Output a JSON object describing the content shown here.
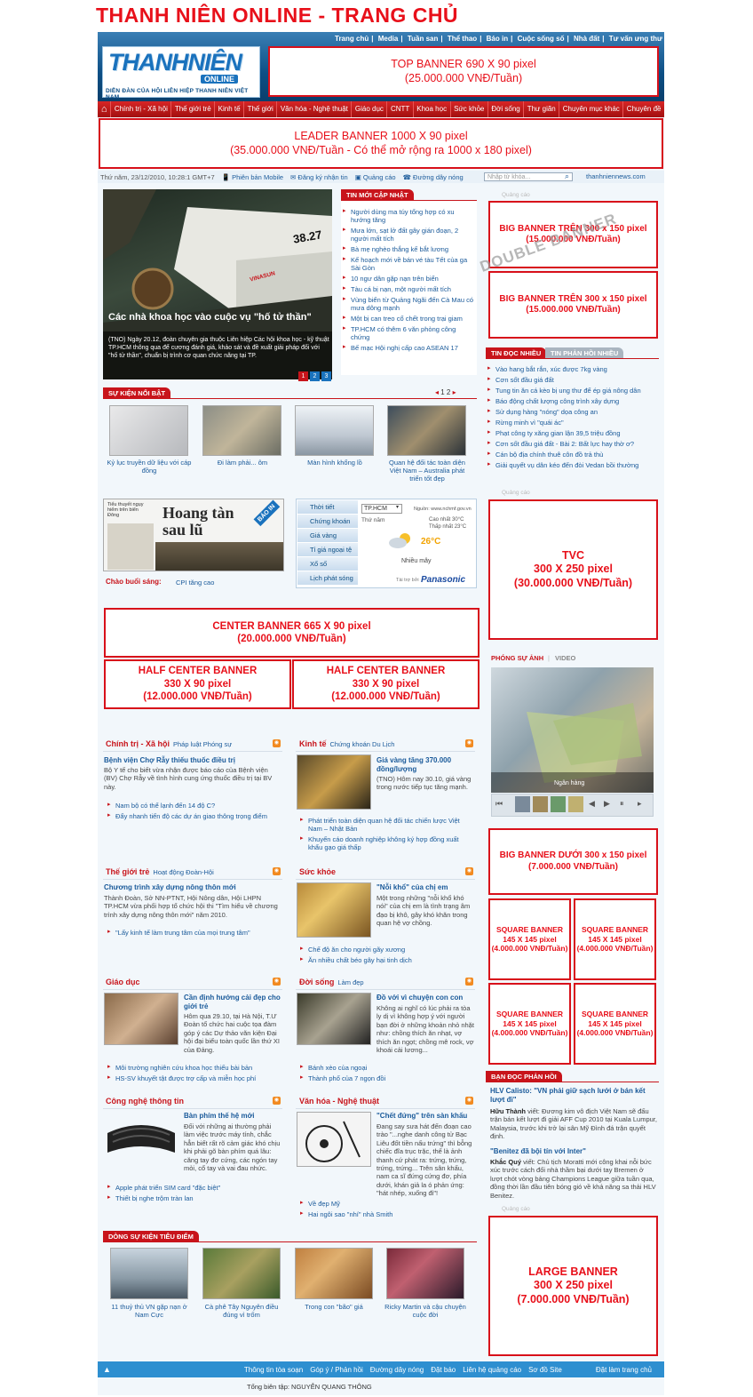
{
  "page_title": "THANH NIÊN ONLINE - TRANG CHỦ",
  "logo": {
    "main": "THANHNIÊN",
    "sub": "ONLINE",
    "tagline": "DIỄN ĐÀN CỦA HỘI LIÊN HIỆP THANH NIÊN VIỆT NAM"
  },
  "top_nav": [
    "Trang chủ",
    "Media",
    "Tuần san",
    "Thể thao",
    "Báo in",
    "Cuộc sống số",
    "Nhà đất",
    "Tư vấn ưng thư"
  ],
  "top_banner": {
    "line1": "TOP BANNER 690 X 90 pixel",
    "line2": "(25.000.000 VNĐ/Tuần)"
  },
  "main_nav": [
    "Chính trị - Xã hội",
    "Thế giới trẻ",
    "Kinh tế",
    "Thế giới",
    "Văn hóa - Nghệ thuật",
    "Giáo dục",
    "CNTT",
    "Khoa học",
    "Sức khỏe",
    "Đời sống",
    "Thư giãn",
    "Chuyên mục khác",
    "Chuyên đề"
  ],
  "leader_banner": {
    "line1": "LEADER BANNER 1000 X 90 pixel",
    "line2": "(35.000.000 VNĐ/Tuần - Có thể mở rộng ra 1000 x 180 pixel)"
  },
  "toolbar": {
    "date": "Thứ năm, 23/12/2010, 10:28:1 GMT+7",
    "mobile": "Phiên bản Mobile",
    "subscribe": "Đăng ký nhận tin",
    "ads": "Quảng cáo",
    "hotline": "Đường dây nóng",
    "search_placeholder": "Nhập từ khóa...",
    "site": "thanhniennews.com"
  },
  "hero": {
    "title": "Các nhà khoa học vào cuộc vụ \"hố tử thần\"",
    "summary": "(TNO) Ngày 20.12, đoàn chuyên gia thuộc Liên hiệp Các hội khoa học - kỹ thuật TP.HCM thông qua để cương đánh giá, khảo sát và đề xuất giải pháp đối với \"hố tử thần\", chuẩn bị trình cơ quan chức năng tại TP.",
    "car_number": "38.27",
    "car_brand": "VINASUN",
    "pages": [
      "1",
      "2",
      "3"
    ]
  },
  "latest": {
    "label": "TIN MỚI CẬP NHẬT",
    "items": [
      "Người dùng ma túy tổng hợp có xu hướng tăng",
      "Mưa lớn, sạt lở đất gây gián đoạn, 2 người mất tích",
      "Bà mẹ nghèo thắng kế bắt lương",
      "Kế hoạch mới về bán vé tàu Tết của ga Sài Gòn",
      "10 ngư dân gặp nạn trên biển",
      "Tàu cá bị nạn, một người mất tích",
      "Vùng biển từ Quảng Ngãi đến Cà Mau có mưa dông mạnh",
      "Một bị can treo cổ chết trong trại giam",
      "TP.HCM có thêm 6 văn phòng công chứng",
      "Bế mạc Hội nghị cấp cao ASEAN 17"
    ]
  },
  "ad_label": "Quảng cáo",
  "big_banner_top": {
    "line1": "BIG BANNER TRÊN 300 x 150 pixel",
    "line2": "(15.000.000 VNĐ/Tuần)"
  },
  "double_banner": "DOUBLE BANNER",
  "most_read": {
    "tab1": "TIN ĐỌC NHIỀU",
    "tab2": "TIN PHẢN HỒI NHIỀU",
    "items": [
      "Vào hang bắt rắn, xúc được 7kg vàng",
      "Cơn sốt đầu giá đất",
      "Tung tin ăn cá kèo bị ung thư để ép giá nông dân",
      "Báo động chất lượng công trình xây dựng",
      "Sử dụng hàng \"nóng\" dọa công an",
      "Rừng minh vì \"quái ác\"",
      "Phạt công ty xăng gian lận 39,5 triệu đồng",
      "Cơn sốt đầu giá đất - Bài 2: Bất lực hay thờ ơ?",
      "Cán bộ địa chính thuê côn đồ trả thù",
      "Giải quyết vụ dân kéo đến đòi Vedan bồi thường"
    ]
  },
  "events": {
    "label": "SỰ KIỆN NỔI BẬT",
    "pager": "1  2",
    "items": [
      "Kỷ lục truyền dữ liệu với cáp đồng",
      "Đi làm phải... ôm",
      "Màn hình khổng lồ",
      "Quan hệ đối tác toàn diện Việt Nam – Australia phát triển tốt đẹp"
    ]
  },
  "print": {
    "headline_small": "Hoang tàn sau lũ",
    "badge": "BÁO IN",
    "title_small": "Tiểu thuyết ngụy hiểm trên biển Đông",
    "greeting_label": "Chào buổi sáng:",
    "greeting_value": "CPI tăng cao"
  },
  "utilities": {
    "items": [
      "Thời tiết",
      "Chứng khoán",
      "Giá vàng",
      "Tỉ giá ngoại tệ",
      "Xổ số",
      "Lịch phát sóng"
    ],
    "city": "TP.HCM",
    "source": "Nguồn: www.nchmf.gov.vn",
    "day": "Thứ năm",
    "high": "Cao nhất 30°C",
    "low": "Thấp nhất 23°C",
    "temp": "26°C",
    "condition": "Nhiều mây",
    "sponsor_label": "Tài trợ bởi",
    "sponsor": "Panasonic"
  },
  "tvc_banner": {
    "line1": "TVC",
    "line2": "300 X 250 pixel",
    "line3": "(30.000.000 VNĐ/Tuần)"
  },
  "center_banner": {
    "line1": "CENTER BANNER 665 X 90 pixel",
    "line2": "(20.000.000 VNĐ/Tuần)"
  },
  "half_center": {
    "line1": "HALF CENTER BANNER",
    "line2": "330 X 90 pixel",
    "line3": "(12.000.000 VNĐ/Tuần)"
  },
  "photo": {
    "tab1": "PHÓNG SỰ ẢNH",
    "tab2": "VIDEO",
    "caption": "Ngân hàng"
  },
  "sections": {
    "politics": {
      "title": "Chính trị - Xã hội",
      "subs": "Pháp luật   Phóng sự",
      "headline": "Bệnh viện Chợ Rẫy thiếu thuốc điều trị",
      "text": "Bộ Y tế cho biết vừa nhận được báo cáo của Bệnh viện (BV) Chợ Rẫy về tình hình cung ứng thuốc điều trị tại BV này.",
      "links": [
        "Nam bộ có thể lạnh đến 14 độ C?",
        "Đẩy nhanh tiến độ các dự án giao thông trọng điểm"
      ]
    },
    "economy": {
      "title": "Kinh tế",
      "subs": "Chứng khoán   Du Lịch",
      "headline": "Giá vàng tăng 370.000 đồng/lượng",
      "text": "(TNO) Hôm nay 30.10, giá vàng trong nước tiếp tục tăng mạnh.",
      "links": [
        "Phát triển toàn diện quan hệ đối tác chiến lược Việt Nam – Nhật Bản",
        "Khuyến cáo doanh nghiệp không ký hợp đồng xuất khẩu gạo giá thấp"
      ]
    },
    "youth": {
      "title": "Thế giới trẻ",
      "subs": "Hoạt động Đoàn-Hội",
      "headline": "Chương trình xây dựng nông thôn mới",
      "text": "Thành Đoàn, Sở NN-PTNT, Hội Nông dân, Hội LHPN TP.HCM vừa phối hợp tổ chức hội thi \"Tìm hiểu về chương trình xây dựng nông thôn mới\" năm 2010.",
      "links": [
        "\"Lấy kinh tế làm trung tâm của mọi trung tâm\""
      ]
    },
    "health": {
      "title": "Sức khỏe",
      "headline": "\"Nỗi khổ\" của chị em",
      "text": "Một trong những \"nỗi khổ khó nói\" của chị em là tình trạng âm đạo bị khô, gây khó khăn trong quan hệ vợ chồng.",
      "links": [
        "Chế độ ăn cho người gãy xương",
        "Ăn nhiều chất béo gây hại tinh dịch"
      ]
    },
    "education": {
      "title": "Giáo dục",
      "headline": "Cần định hướng cải đẹp cho giới trẻ",
      "text": "Hôm qua 29.10, tại Hà Nội, T.Ư Đoàn tổ chức hai cuộc tọa đàm góp ý các Dự thảo văn kiện Đại hội đại biểu toàn quốc lần thứ XI của Đảng.",
      "links": [
        "Môi trường nghiên cứu khoa học thiếu bài bản",
        "HS-SV khuyết tật được trợ cấp và miễn học phí"
      ]
    },
    "life": {
      "title": "Đời sống",
      "subs": "Làm đẹp",
      "headline": "Đồ với vì chuyện con con",
      "text": "Không ai nghĩ có lúc phải ra tòa ly dị vì không hợp ý với người bạn đời ở những khoản nhỏ nhặt như: chồng thích ăn nhạt, vợ thích ăn ngọt; chồng mê rock, vợ khoái cải lương...",
      "links": [
        "Bánh xèo của ngoại",
        "Thành phố của 7 ngọn đồi"
      ]
    },
    "tech": {
      "title": "Công nghệ thông tin",
      "headline": "Bàn phím thế hệ mới",
      "text": "Đối với những ai thường phải làm việc trước máy tính, chắc hẳn biết rất rõ cảm giác khó chịu khi phải gõ bàn phím quá lâu: căng tay đơ cứng, các ngón tay mỏi, cổ tay và vai đau nhức.",
      "links": [
        "Apple phát triển SIM card \"đặc biệt\"",
        "Thiết bị nghe trộm tràn lan"
      ]
    },
    "culture": {
      "title": "Văn hóa - Nghệ thuật",
      "headline": "\"Chết đứng\" trên sàn khấu",
      "text": "Đang say sưa hát đến đoạn cao trào \"...nghe danh công tử Bạc Liêu đốt tiền nấu trứng\" thì bỗng chiếc đĩa trục trặc, thế là ảnh thanh cứ phát ra: trứng, trứng, trứng, trứng... Trên sân khấu, nam ca sĩ đứng cứng đơ, phía dưới, khán giả la ó phản ứng: \"hát nhép, xuống đi\"!",
      "links": [
        "Về đẹp Mỹ",
        "Hai ngôi sao \"nhí\" nhà Smith"
      ]
    }
  },
  "big_banner_bottom": {
    "line1": "BIG BANNER DƯỚI 300 x 150 pixel",
    "line2": "(7.000.000 VNĐ/Tuần)"
  },
  "square_banner": {
    "line1": "SQUARE BANNER",
    "line2": "145 X 145 pixel",
    "line3": "(4.000.000 VNĐ/Tuần)"
  },
  "feedback": {
    "label": "BẠN ĐỌC PHẢN HỒI",
    "q1": "HLV Calisto: \"VN phải giữ sạch lưới ở bán kết lượt đi\"",
    "a1_name": "Hữu Thành",
    "a1": "viết: Đương kim vô địch Việt Nam sẽ đấu trận bán kết lượt đi giải AFF Cup 2010 tại Kuala Lumpur, Malaysia, trước khi trở lại sân Mỹ Đình đá trận quyết định.",
    "q2": "\"Benitez đã bội tín với Inter\"",
    "a2_name": "Khắc Quý",
    "a2": "viết: Chủ tịch Moratti mới công khai nỗi bức xúc trước cách đối nhà thầm bại dưới tay Bremen ở lượt chót vòng bảng Champions League giữa tuần qua, đồng thời lần đầu tiên bóng gió về khả năng sa thải HLV Benitez."
  },
  "large_banner": {
    "line1": "LARGE BANNER",
    "line2": "300 X 250 pixel",
    "line3": "(7.000.000 VNĐ/Tuần)"
  },
  "focus": {
    "label": "DÒNG SỰ KIỆN TIÊU ĐIỂM",
    "items": [
      "11 thuỷ thủ VN gặp nạn ở Nam Cực",
      "Cà phê Tây Nguyên điều đúng vì trốm",
      "Trong con \"bão\" giá",
      "Ricky Martin và cậu chuyện cuộc đời"
    ]
  },
  "footer": {
    "links": [
      "Thông tin tòa soạn",
      "Góp ý / Phản hồi",
      "Đường dây nóng",
      "Đặt báo",
      "Liên hệ quảng cáo",
      "Sơ đồ Site"
    ],
    "home": "Đặt làm trang chủ",
    "editor": "Tổng biên tập: NGUYỄN QUANG THÔNG"
  }
}
